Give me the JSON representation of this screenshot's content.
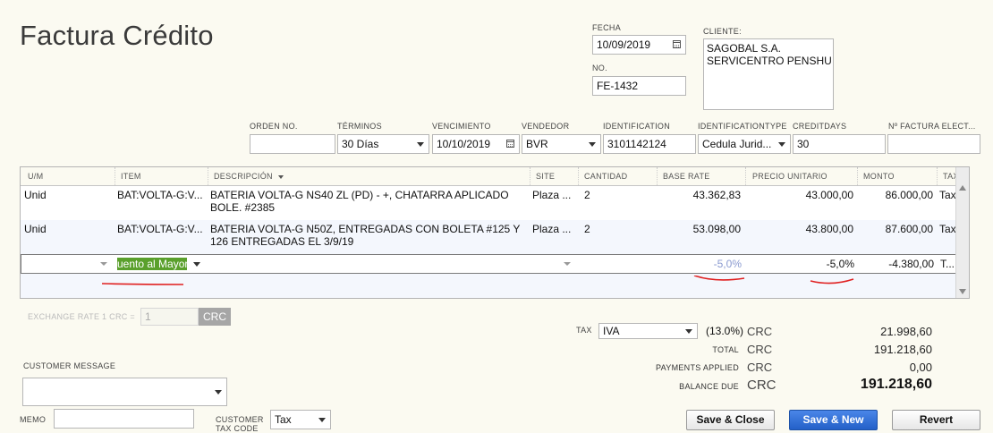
{
  "form": {
    "title": "Factura Crédito"
  },
  "header": {
    "fecha_label": "FECHA",
    "fecha": "10/09/2019",
    "no_label": "NO.",
    "no": "FE-1432",
    "cliente_label": "CLIENTE:",
    "cliente_line1": "SAGOBAL S.A.",
    "cliente_line2": "SERVICENTRO PENSHU"
  },
  "fields": {
    "orden_label": "ORDEN NO.",
    "orden": "",
    "terminos_label": "TéRMINOS",
    "terminos": "30 Días",
    "vencimiento_label": "VENCIMIENTO",
    "vencimiento": "10/10/2019",
    "vendedor_label": "VENDEDOR",
    "vendedor": "BVR",
    "identification_label": "IDENTIFICATION",
    "identification": "3101142124",
    "idtype_label": "IDENTIFICATIONTYPE",
    "idtype": "Cedula Jurid...",
    "creditdays_label": "CREDITDAYS",
    "creditdays": "30",
    "nfactura_label": "Nº FACTURA ELECT..."
  },
  "table": {
    "columns": [
      "U/M",
      "ITEM",
      "DESCRIPCIÓN",
      "SITE",
      "CANTIDAD",
      "BASE RATE",
      "PRECIO UNITARIO",
      "MONTO",
      "TAX"
    ],
    "rows": [
      {
        "um": "Unid",
        "item": "BAT:VOLTA-G:V...",
        "desc": "BATERIA VOLTA-G NS40 ZL (PD) - +, CHATARRA  APLICADO BOLE. #2385",
        "site": "Plaza ...",
        "cantidad": "2",
        "base_rate": "43.362,83",
        "precio": "43.000,00",
        "monto": "86.000,00",
        "tax": "Tax"
      },
      {
        "um": "Unid",
        "item": "BAT:VOLTA-G:V...",
        "desc": "BATERIA VOLTA-G N50Z, ENTREGADAS CON BOLETA  #125 Y 126 ENTREGADAS EL  3/9/19",
        "site": "Plaza ...",
        "cantidad": "2",
        "base_rate": "53.098,00",
        "precio": "43.800,00",
        "monto": "87.600,00",
        "tax": "Tax"
      }
    ],
    "edit_row": {
      "item": "uento al Mayor",
      "base_rate": "-5,0%",
      "precio": "-5,0%",
      "monto": "-4.380,00",
      "tax": "T..."
    }
  },
  "exchange": {
    "label": "EXCHANGE RATE 1 CRC =",
    "value": "1",
    "currency": "CRC"
  },
  "customer_message": {
    "label": "CUSTOMER MESSAGE",
    "value": ""
  },
  "memo": {
    "label": "MEMO",
    "value": ""
  },
  "customer_tax": {
    "label": "CUSTOMER TAX CODE",
    "value": "Tax"
  },
  "totals": {
    "tax_label": "TAX",
    "tax_code": "IVA",
    "tax_rate": "(13.0%)",
    "tax_currency": "CRC",
    "tax_value": "21.998,60",
    "total_label": "TOTAL",
    "total_currency": "CRC",
    "total_value": "191.218,60",
    "payments_label": "PAYMENTS APPLIED",
    "payments_currency": "CRC",
    "payments_value": "0,00",
    "balance_label": "BALANCE DUE",
    "balance_currency": "CRC",
    "balance_value": "191.218,60"
  },
  "buttons": {
    "save_close": "Save & Close",
    "save_new": "Save & New",
    "revert": "Revert"
  },
  "colors": {
    "background": "#fbfaf1",
    "primary_button": "#2f6fd6",
    "highlight_green": "#5aa02c",
    "annotation_red": "#e02020"
  }
}
